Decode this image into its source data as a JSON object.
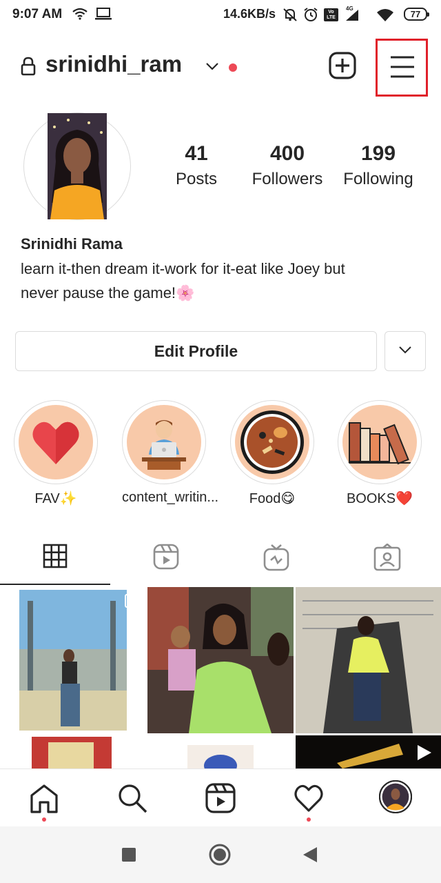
{
  "status_bar": {
    "time": "9:07 AM",
    "speed": "14.6KB/s",
    "battery": "77",
    "network": "4G",
    "volte": "Vo LTE",
    "icons": [
      "wifi-icon",
      "cast-icon",
      "mute-icon",
      "alarm-icon",
      "volte-icon",
      "signal-icon",
      "wifi-icon",
      "battery-icon"
    ]
  },
  "header": {
    "username": "srinidhi_ram",
    "icons": [
      "lock-icon",
      "chevron-down-icon",
      "notification-dot",
      "add-post-icon",
      "menu-icon"
    ]
  },
  "profile": {
    "stats": [
      {
        "value": "41",
        "label": "Posts"
      },
      {
        "value": "400",
        "label": "Followers"
      },
      {
        "value": "199",
        "label": "Following"
      }
    ],
    "name": "Srinidhi Rama",
    "bio_line1": "learn it-then dream it-work for it-eat like Joey but",
    "bio_line2": "never pause the game!🌸"
  },
  "actions": {
    "edit_profile": "Edit Profile"
  },
  "highlights": [
    {
      "label": "FAV✨",
      "icon": "heart-icon"
    },
    {
      "label": "content_writin...",
      "icon": "laptop-person-icon"
    },
    {
      "label": "Food😋",
      "icon": "food-plate-icon"
    },
    {
      "label": "BOOKS❤️",
      "icon": "books-icon"
    }
  ],
  "tabs": [
    "grid-icon",
    "reels-icon",
    "igtv-icon",
    "tagged-icon"
  ],
  "bottom_nav": [
    "home-icon",
    "search-icon",
    "reels-icon",
    "heart-icon",
    "profile-avatar"
  ],
  "colors": {
    "accent_red": "#ed4956",
    "highlight_bg": "#f8c9a9",
    "border": "#dbdbdb",
    "text": "#262626"
  }
}
